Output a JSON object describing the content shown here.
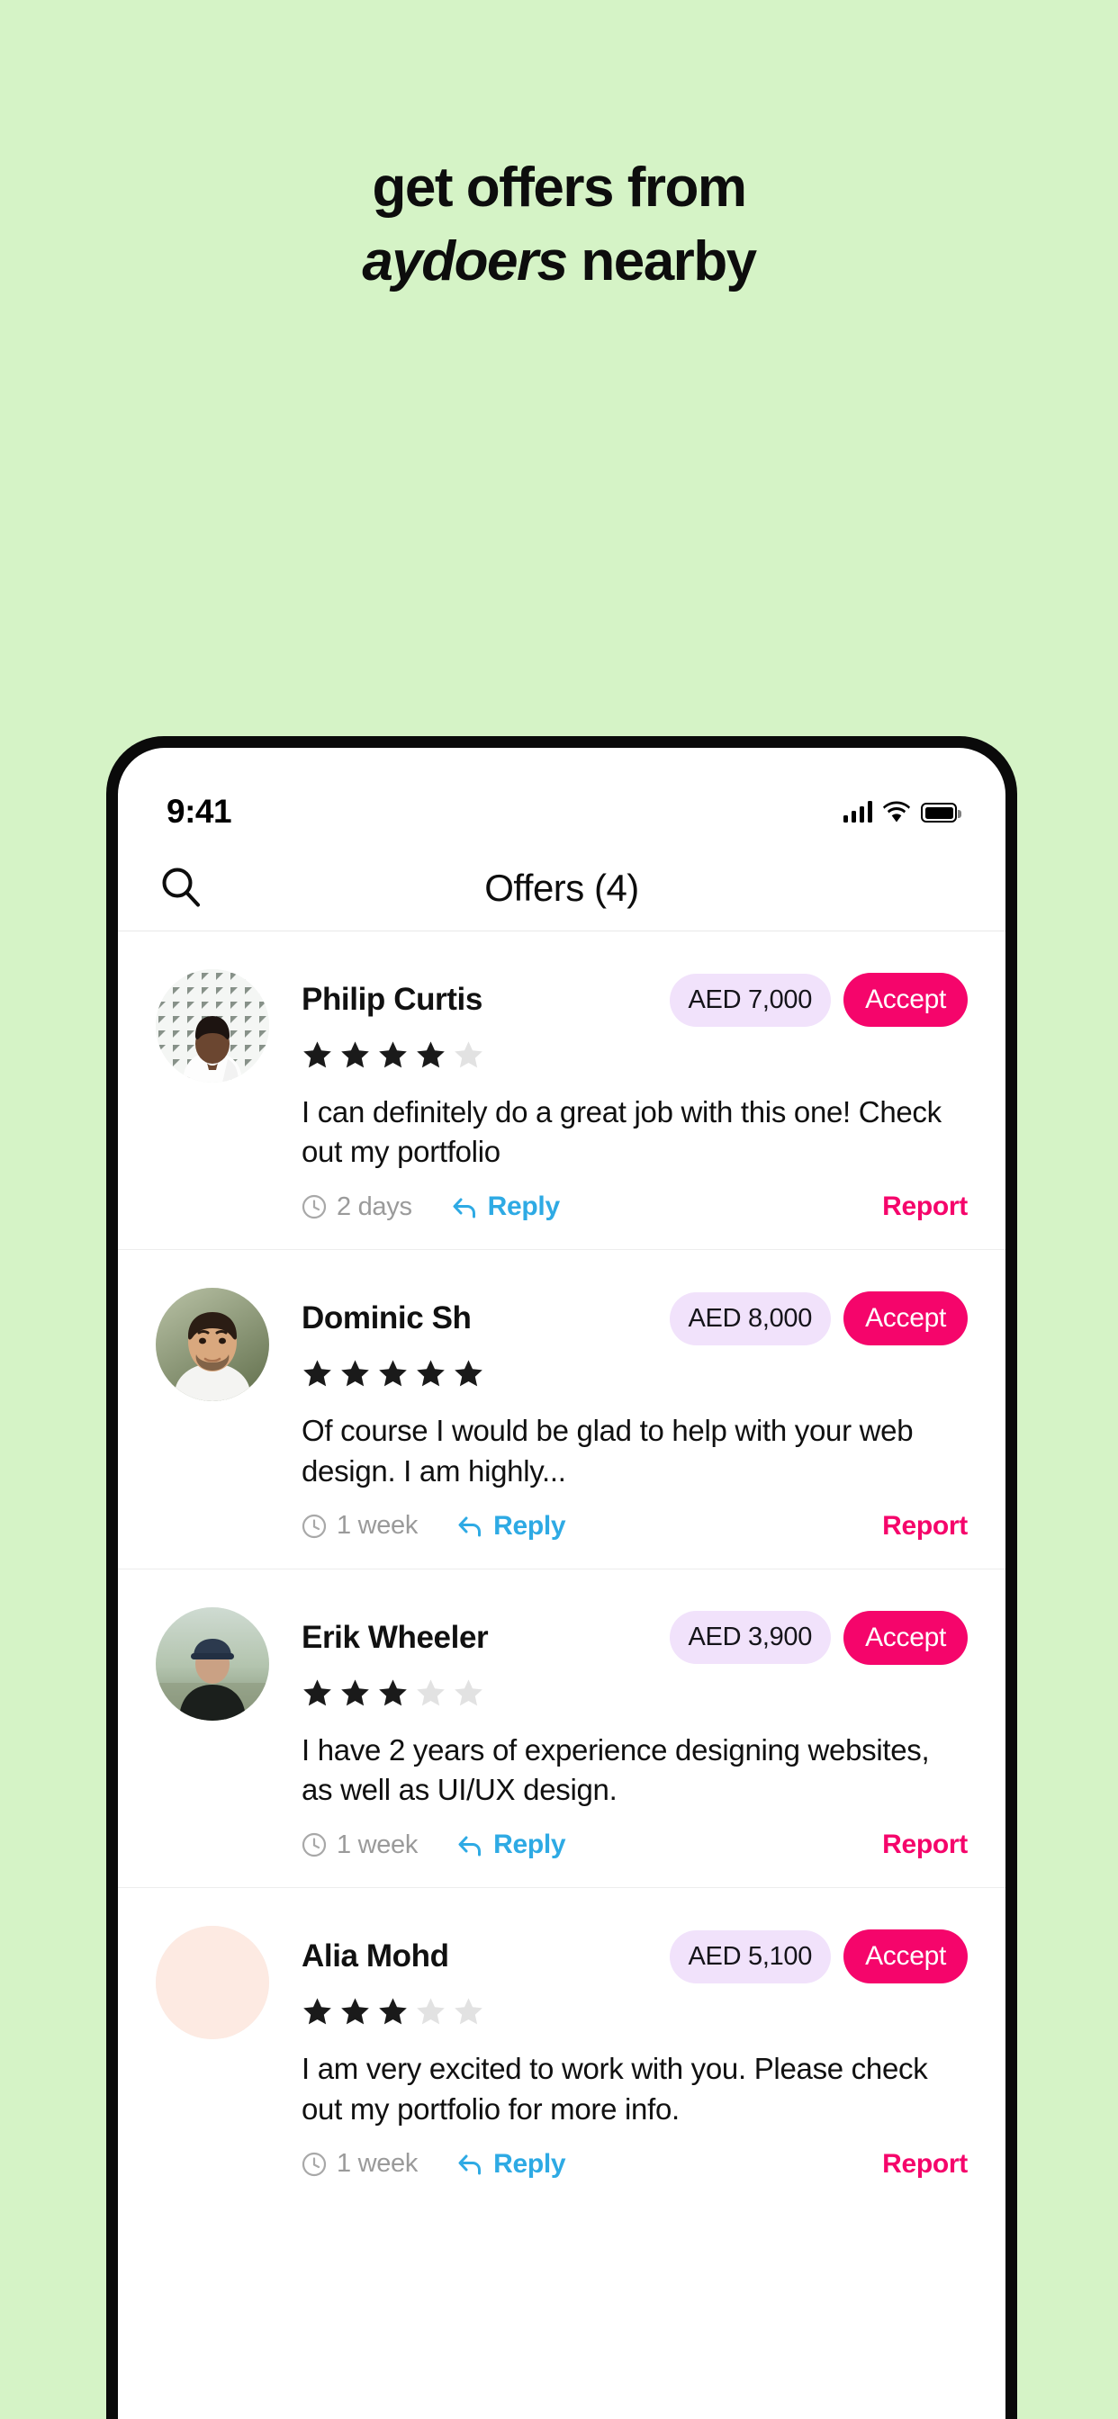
{
  "promo": {
    "background_color": "#d5f3c6",
    "headline_line1": "get offers from",
    "headline_italic": "aydoers",
    "headline_rest": " nearby"
  },
  "colors": {
    "accent_pink": "#f5056b",
    "reply_blue": "#2eaae4",
    "price_badge_bg": "#f1e2fb",
    "star_filled": "#1a1a1a",
    "star_empty": "#e2e2e2",
    "muted_text": "#9a9a9a"
  },
  "statusbar": {
    "time": "9:41",
    "signal_icon": "cellular-bars-icon",
    "wifi_icon": "wifi-icon",
    "battery_icon": "battery-full-icon"
  },
  "header": {
    "search_icon": "search-icon",
    "title": "Offers (4)"
  },
  "offers": [
    {
      "name": "Philip Curtis",
      "price": "AED 7,000",
      "accept_label": "Accept",
      "rating": 4,
      "max_rating": 5,
      "message": "I can definitely do a great job with this one! Check out my portfolio",
      "time": "2 days",
      "reply_label": "Reply",
      "report_label": "Report",
      "avatar_name": "avatar-philip-curtis"
    },
    {
      "name": "Dominic Sh",
      "price": "AED 8,000",
      "accept_label": "Accept",
      "rating": 5,
      "max_rating": 5,
      "message": "Of course I would be glad to help with your web design. I am highly...",
      "time": "1 week",
      "reply_label": "Reply",
      "report_label": "Report",
      "avatar_name": "avatar-dominic-sh"
    },
    {
      "name": "Erik Wheeler",
      "price": "AED 3,900",
      "accept_label": "Accept",
      "rating": 3,
      "max_rating": 5,
      "message": "I have 2 years of experience designing websites, as well as UI/UX design.",
      "time": "1 week",
      "reply_label": "Reply",
      "report_label": "Report",
      "avatar_name": "avatar-erik-wheeler"
    },
    {
      "name": "Alia Mohd",
      "price": "AED 5,100",
      "accept_label": "Accept",
      "rating": 3,
      "max_rating": 5,
      "message": "I am very excited to work with you. Please check out my portfolio for more info.",
      "time": "1 week",
      "reply_label": "Reply",
      "report_label": "Report",
      "avatar_name": "avatar-alia-mohd"
    }
  ]
}
